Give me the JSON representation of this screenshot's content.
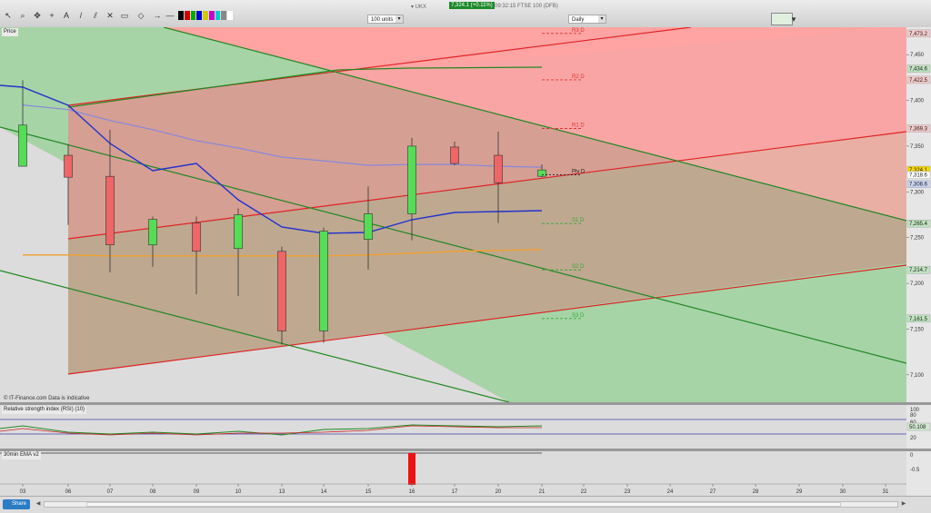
{
  "toolbar": {
    "title": "▾ UKX",
    "price_badge": "7,324.1 (+0.11%)",
    "status": "09:32:15 FTSE 100 (DFB)",
    "units": "100 units",
    "period": "Daily",
    "icons": [
      "pointer-icon",
      "zoom-icon",
      "pan-icon",
      "crosshair-icon",
      "text-icon",
      "delete-icon",
      "rectangle-icon",
      "channel-icon",
      "line-icon",
      "arrow-icon",
      "color-swatches-icon",
      "chart-thumbnail-icon"
    ]
  },
  "price_panel": {
    "label": "Price",
    "copyright": "© IT-Finance.com  Data is indicative"
  },
  "rsi_panel": {
    "label": "Relative strength index (RSI) (10)",
    "ticks": [
      "100",
      "80",
      "60",
      "20"
    ],
    "value": "50.108"
  },
  "ema_panel": {
    "label": "30min EMA v2",
    "ticks": [
      "0",
      "-0.5"
    ]
  },
  "bottom": {
    "share_label": "Share"
  },
  "chart_data": {
    "type": "candlestick",
    "x_labels": [
      "03",
      "06",
      "07",
      "08",
      "09",
      "10",
      "13",
      "14",
      "15",
      "16",
      "17",
      "20",
      "21",
      "22",
      "23",
      "24",
      "27",
      "28",
      "29",
      "30",
      "31"
    ],
    "ylim": [
      7070,
      7480
    ],
    "y_ticks": [
      7450,
      7400,
      7350,
      7300,
      7250,
      7200,
      7150,
      7100
    ],
    "candles": [
      {
        "x": "03",
        "open": 7328,
        "high": 7422,
        "low": 7334,
        "close": 7373
      },
      {
        "x": "06",
        "open": 7340,
        "high": 7352,
        "low": 7264,
        "close": 7316
      },
      {
        "x": "07",
        "open": 7317,
        "high": 7368,
        "low": 7212,
        "close": 7242
      },
      {
        "x": "08",
        "open": 7242,
        "high": 7273,
        "low": 7218,
        "close": 7270
      },
      {
        "x": "09",
        "open": 7266,
        "high": 7273,
        "low": 7188,
        "close": 7235
      },
      {
        "x": "10",
        "open": 7238,
        "high": 7282,
        "low": 7186,
        "close": 7275
      },
      {
        "x": "13",
        "open": 7235,
        "high": 7240,
        "low": 7133,
        "close": 7148
      },
      {
        "x": "14",
        "open": 7148,
        "high": 7261,
        "low": 7135,
        "close": 7257
      },
      {
        "x": "15",
        "open": 7248,
        "high": 7306,
        "low": 7215,
        "close": 7276
      },
      {
        "x": "16",
        "open": 7276,
        "high": 7359,
        "low": 7247,
        "close": 7350
      },
      {
        "x": "17",
        "open": 7349,
        "high": 7355,
        "low": 7329,
        "close": 7331
      },
      {
        "x": "20",
        "open": 7340,
        "high": 7366,
        "low": 7266,
        "close": 7310
      },
      {
        "x": "21",
        "open": 7317,
        "high": 7330,
        "low": 7316,
        "close": 7324
      }
    ],
    "right_labels": [
      {
        "value": 7473.2,
        "text": "7,473.2",
        "color": "#f4c9c9"
      },
      {
        "value": 7434.6,
        "text": "7,434.6",
        "color": "#bfe3bf"
      },
      {
        "value": 7422.5,
        "text": "7,422.5",
        "color": "#f4c9c9"
      },
      {
        "value": 7369.3,
        "text": "7,369.3",
        "color": "#f4c9c9"
      },
      {
        "value": 7324.1,
        "text": "7,324.1",
        "color": "#f5d800"
      },
      {
        "value": 7318.6,
        "text": "7,318.6",
        "color": "#ffffff"
      },
      {
        "value": 7308.6,
        "text": "7,308.6",
        "color": "#c9d4f4"
      },
      {
        "value": 7265.4,
        "text": "7,265.4",
        "color": "#bfe3bf"
      },
      {
        "value": 7214.7,
        "text": "7,214.7",
        "color": "#bfe3bf"
      },
      {
        "value": 7161.5,
        "text": "7,161.5",
        "color": "#bfe3bf"
      }
    ],
    "pivots": [
      {
        "label": "R3 D",
        "value": 7473.2,
        "color": "#d33"
      },
      {
        "label": "R2 D",
        "value": 7422.5,
        "color": "#d33"
      },
      {
        "label": "R1 D",
        "value": 7369.3,
        "color": "#d33"
      },
      {
        "label": "Piv D",
        "value": 7318.6,
        "color": "#222"
      },
      {
        "label": "S1 D",
        "value": 7265.4,
        "color": "#3a3"
      },
      {
        "label": "S2 D",
        "value": 7214.7,
        "color": "#3a3"
      },
      {
        "label": "S3 D",
        "value": 7161.5,
        "color": "#3a3"
      }
    ],
    "colors": {
      "up": "#55dd55",
      "down": "#ee6666",
      "ma_blue": "#2233cc",
      "ma_lavender": "#8888dd",
      "ma_orange": "#f0a030",
      "ma_green": "#228822"
    }
  }
}
